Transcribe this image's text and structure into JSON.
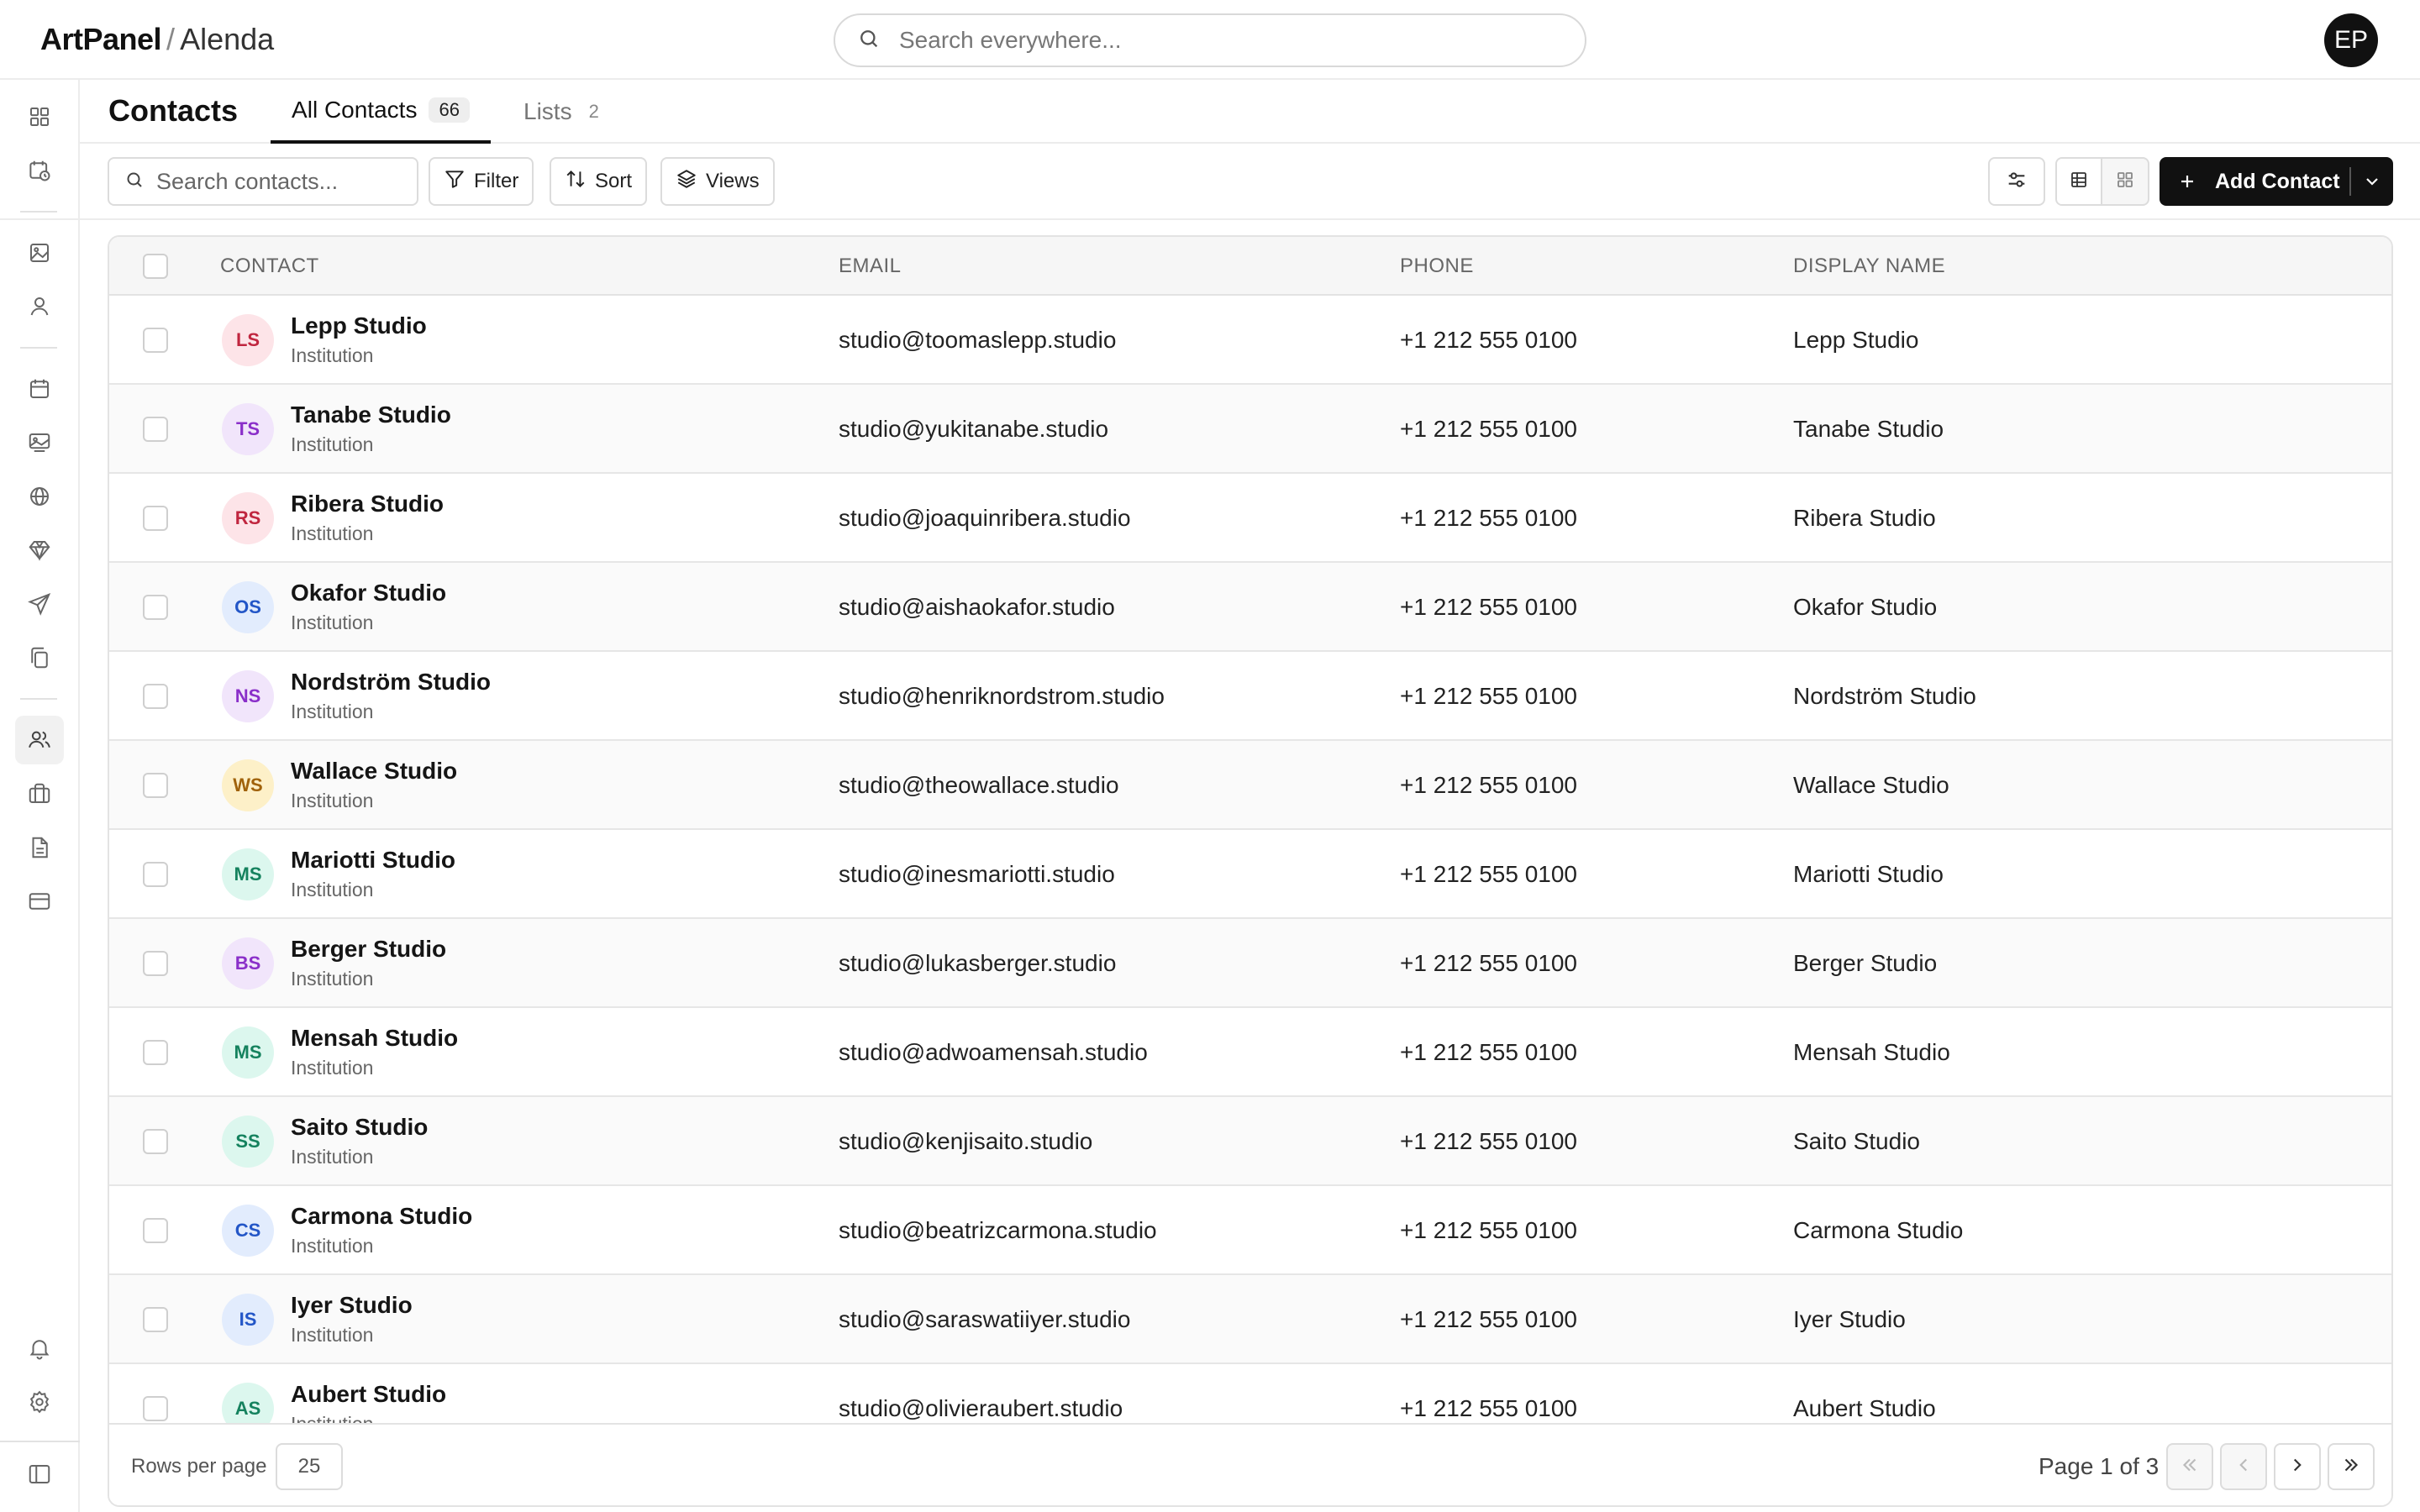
{
  "app": {
    "name": "ArtPanel",
    "separator": "/",
    "workspace": "Alenda"
  },
  "global_search": {
    "placeholder": "Search everywhere..."
  },
  "user": {
    "initials": "EP"
  },
  "page": {
    "title": "Contacts"
  },
  "tabs": [
    {
      "label": "All Contacts",
      "count": "66"
    },
    {
      "label": "Lists",
      "count": "2"
    }
  ],
  "toolbar": {
    "search_placeholder": "Search contacts...",
    "filter_label": "Filter",
    "sort_label": "Sort",
    "views_label": "Views",
    "add_label": "Add Contact"
  },
  "table": {
    "columns": {
      "contact": "CONTACT",
      "email": "EMAIL",
      "phone": "PHONE",
      "display": "DISPLAY NAME"
    },
    "rows": [
      {
        "initials": "LS",
        "name": "Lepp Studio",
        "type": "Institution",
        "email": "studio@toomaslepp.studio",
        "phone": "+1 212 555 0100",
        "display": "Lepp Studio",
        "avatar_bg": "#fde4e8",
        "avatar_fg": "#c0263f"
      },
      {
        "initials": "TS",
        "name": "Tanabe Studio",
        "type": "Institution",
        "email": "studio@yukitanabe.studio",
        "phone": "+1 212 555 0100",
        "display": "Tanabe Studio",
        "avatar_bg": "#f1e5fb",
        "avatar_fg": "#8a2fc9"
      },
      {
        "initials": "RS",
        "name": "Ribera Studio",
        "type": "Institution",
        "email": "studio@joaquinribera.studio",
        "phone": "+1 212 555 0100",
        "display": "Ribera Studio",
        "avatar_bg": "#fde4e8",
        "avatar_fg": "#c0263f"
      },
      {
        "initials": "OS",
        "name": "Okafor Studio",
        "type": "Institution",
        "email": "studio@aishaokafor.studio",
        "phone": "+1 212 555 0100",
        "display": "Okafor Studio",
        "avatar_bg": "#e2ecfd",
        "avatar_fg": "#2356c7"
      },
      {
        "initials": "NS",
        "name": "Nordström Studio",
        "type": "Institution",
        "email": "studio@henriknordstrom.studio",
        "phone": "+1 212 555 0100",
        "display": "Nordström Studio",
        "avatar_bg": "#f1e5fb",
        "avatar_fg": "#8a2fc9"
      },
      {
        "initials": "WS",
        "name": "Wallace Studio",
        "type": "Institution",
        "email": "studio@theowallace.studio",
        "phone": "+1 212 555 0100",
        "display": "Wallace Studio",
        "avatar_bg": "#fdf0c8",
        "avatar_fg": "#a0620b"
      },
      {
        "initials": "MS",
        "name": "Mariotti Studio",
        "type": "Institution",
        "email": "studio@inesmariotti.studio",
        "phone": "+1 212 555 0100",
        "display": "Mariotti Studio",
        "avatar_bg": "#dcf7ee",
        "avatar_fg": "#15825e"
      },
      {
        "initials": "BS",
        "name": "Berger Studio",
        "type": "Institution",
        "email": "studio@lukasberger.studio",
        "phone": "+1 212 555 0100",
        "display": "Berger Studio",
        "avatar_bg": "#f1e5fb",
        "avatar_fg": "#8a2fc9"
      },
      {
        "initials": "MS",
        "name": "Mensah Studio",
        "type": "Institution",
        "email": "studio@adwoamensah.studio",
        "phone": "+1 212 555 0100",
        "display": "Mensah Studio",
        "avatar_bg": "#dcf7ee",
        "avatar_fg": "#15825e"
      },
      {
        "initials": "SS",
        "name": "Saito Studio",
        "type": "Institution",
        "email": "studio@kenjisaito.studio",
        "phone": "+1 212 555 0100",
        "display": "Saito Studio",
        "avatar_bg": "#dcf7ee",
        "avatar_fg": "#15825e"
      },
      {
        "initials": "CS",
        "name": "Carmona Studio",
        "type": "Institution",
        "email": "studio@beatrizcarmona.studio",
        "phone": "+1 212 555 0100",
        "display": "Carmona Studio",
        "avatar_bg": "#e2ecfd",
        "avatar_fg": "#2356c7"
      },
      {
        "initials": "IS",
        "name": "Iyer Studio",
        "type": "Institution",
        "email": "studio@saraswatiiyer.studio",
        "phone": "+1 212 555 0100",
        "display": "Iyer Studio",
        "avatar_bg": "#e2ecfd",
        "avatar_fg": "#2356c7"
      },
      {
        "initials": "AS",
        "name": "Aubert Studio",
        "type": "Institution",
        "email": "studio@olivieraubert.studio",
        "phone": "+1 212 555 0100",
        "display": "Aubert Studio",
        "avatar_bg": "#dcf7ee",
        "avatar_fg": "#15825e"
      }
    ]
  },
  "footer": {
    "rows_per_page_label": "Rows per page",
    "rows_per_page": "25",
    "page_info": "Page 1 of 3"
  },
  "icons": {
    "sidebar": [
      "dashboard-icon",
      "calendar-clock-icon",
      "image-icon",
      "user-icon",
      "calendar-icon",
      "gallery-icon",
      "globe-icon",
      "gem-icon",
      "send-icon",
      "copy-icon",
      "contacts-icon",
      "briefcase-icon",
      "document-icon",
      "credit-card-icon",
      "bell-icon",
      "gear-icon",
      "sidebar-toggle-icon"
    ]
  }
}
